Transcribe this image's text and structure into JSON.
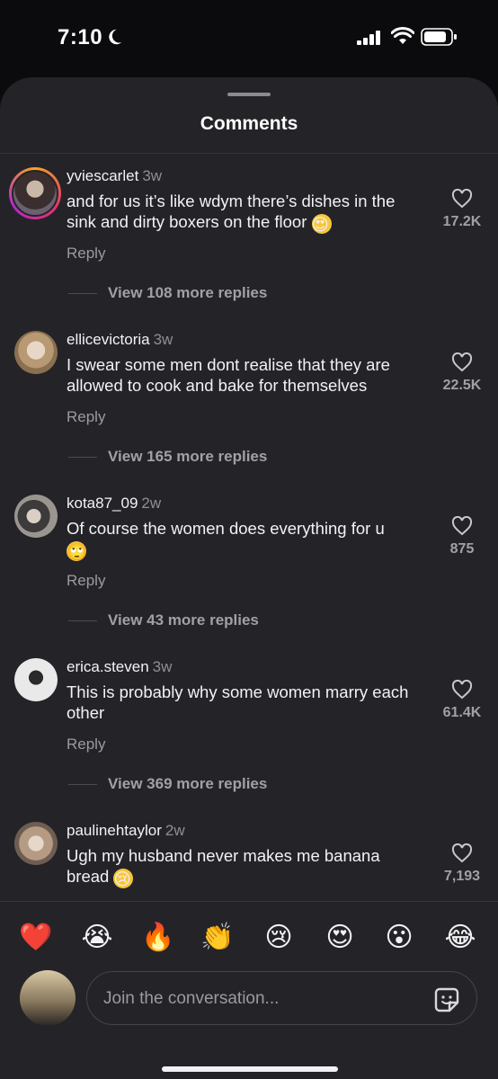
{
  "status_bar": {
    "time": "7:10"
  },
  "sheet": {
    "title": "Comments"
  },
  "comments": [
    {
      "username": "yviescarlet",
      "time": "3w",
      "text": "and for us it’s like wdym there’s dishes in the sink and dirty boxers on the floor",
      "likes": "17.2K",
      "reply_label": "Reply",
      "view_more": "View 108 more replies",
      "avatar_ring": true
    },
    {
      "username": "ellicevictoria",
      "time": "3w",
      "text": "I swear some men dont realise that they are allowed to cook and bake for themselves",
      "likes": "22.5K",
      "reply_label": "Reply",
      "view_more": "View 165 more replies"
    },
    {
      "username": "kota87_09",
      "time": "2w",
      "text": "Of course the women does everything for u",
      "likes": "875",
      "reply_label": "Reply",
      "view_more": "View 43 more replies"
    },
    {
      "username": "erica.steven",
      "time": "3w",
      "text": "This is probably why some women marry each other",
      "likes": "61.4K",
      "reply_label": "Reply",
      "view_more": "View 369 more replies"
    },
    {
      "username": "paulinehtaylor",
      "time": "2w",
      "text": "Ugh my husband never makes me banana bread",
      "likes": "7,193"
    }
  ],
  "emoji_bar": [
    "❤️",
    "😭",
    "🔥",
    "👏",
    "😢",
    "😍",
    "😮",
    "😂"
  ],
  "composer": {
    "placeholder": "Join the conversation..."
  },
  "colors": {
    "sheet_bg": "#242428",
    "like_ring": "#e8336c",
    "muted_text": "#9a9aa1"
  },
  "icons": [
    "moon-icon",
    "signal-icon",
    "wifi-icon",
    "battery-icon",
    "heart-icon",
    "sticker-icon"
  ]
}
